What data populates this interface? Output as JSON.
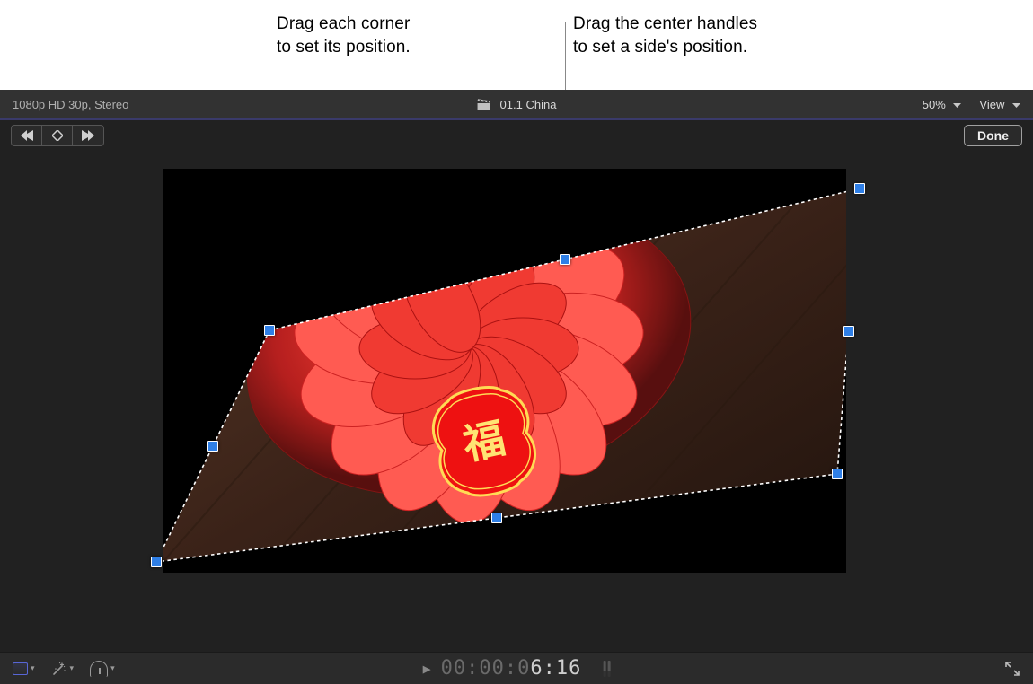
{
  "callouts": {
    "corner_line1": "Drag each corner",
    "corner_line2": "to set its position.",
    "center_line1": "Drag the center handles",
    "center_line2": "to set a side's position."
  },
  "top_bar": {
    "format": "1080p HD 30p, Stereo",
    "clip_name": "01.1 China",
    "zoom": "50%",
    "view_label": "View"
  },
  "toolbar": {
    "done_label": "Done"
  },
  "timecode": {
    "dim": "00:00:0",
    "bright": "6:16"
  },
  "colors": {
    "handle": "#2f7fe6"
  }
}
